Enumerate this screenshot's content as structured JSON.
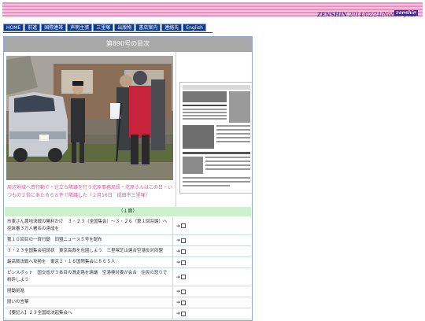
{
  "header": {
    "brand": "zenshin",
    "paper_name": "ZENSHIN",
    "issue_info": "2014/02/24(No890 p02)"
  },
  "nav": {
    "items": [
      "HOME",
      "前進",
      "国際連帯",
      "声明主張",
      "三里塚",
      "出版物",
      "書店案内",
      "連絡先",
      "English"
    ]
  },
  "panel": {
    "title": "第890号の目次",
    "caption": "周辺地域へ斉行動で・辻立ち隣議を行う北原事務局長・北原さんはこの日・いつもの２倍にあたる６８件で隣議した（２月16日　成田市三里塚）",
    "section": "（１面）"
  },
  "toc": [
    {
      "text": "市東さん農地決戦の勝利かけ　３・２３（全国集会）〜３・２６（第１回弁論）へ　控訴審３万人署名の達成を"
    },
    {
      "text": "第１０回目の一斉行動　同盟ニュース５号を配布"
    },
    {
      "text": "３・２３全国集会招請状　東京高裁を包囲しよう　三里塚芝山連合空港反対同盟"
    },
    {
      "text": "最高裁決戦へ攻勢を　東京２・１６国際集会に６６５人"
    },
    {
      "text": "ピンスポット　国交省が３本目の滑走路を論議　空港検討委が会合　住民の怒りで粉砕しよう"
    },
    {
      "text": "闘動前進"
    },
    {
      "text": "闘いの言葉"
    },
    {
      "text": "【要記入】２３全国総決起集会へ"
    }
  ],
  "colors": {
    "banner": "#f08cc0",
    "nav_bg": "#0c3c8c",
    "caption": "#e0509a",
    "section_bg": "#ccf2cc"
  }
}
